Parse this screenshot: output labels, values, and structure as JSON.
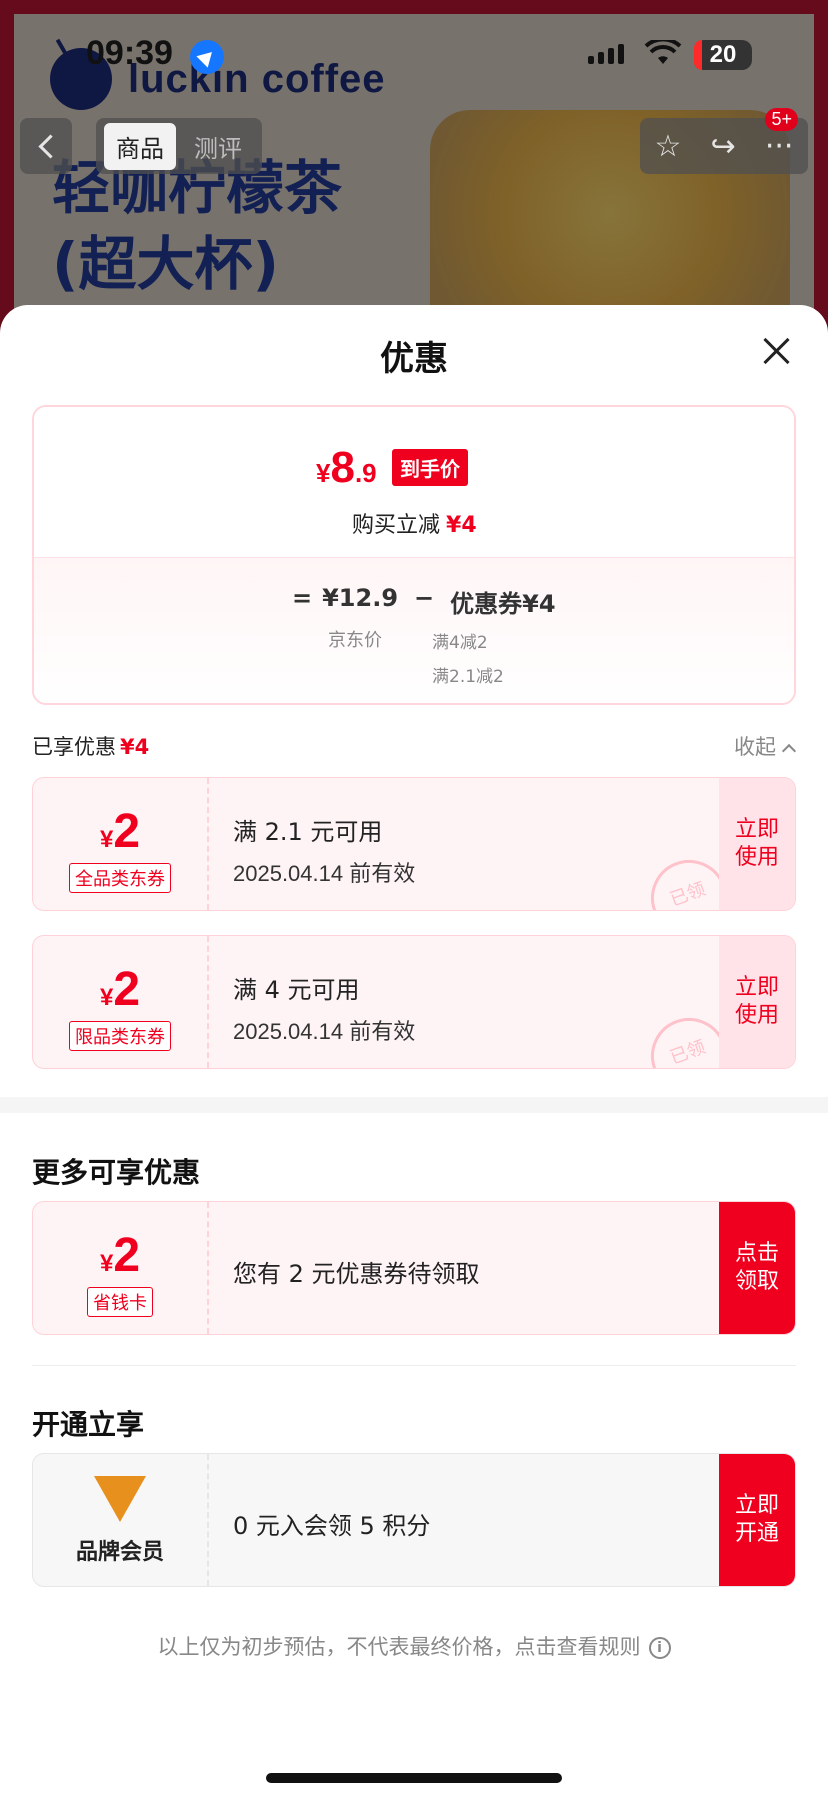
{
  "status_bar": {
    "time": "09:39",
    "battery": "20"
  },
  "background": {
    "brand": "luckin coffee",
    "product_title_line1": "轻咖柠檬茶",
    "product_title_line2": "(超大杯)"
  },
  "nav": {
    "tabs": [
      "商品",
      "测评"
    ],
    "badge": "5+"
  },
  "sheet": {
    "title": "优惠",
    "summary": {
      "currency": "¥",
      "price_int": "8",
      "price_dec": ".9",
      "tag": "到手价",
      "instant_label": "购买立减",
      "instant_amount": "¥4",
      "eq": "=",
      "jd_price": "¥12.9",
      "minus": "−",
      "coupon_total": "优惠券¥4",
      "jd_price_label": "京东价",
      "rule1": "满4减2",
      "rule2": "满2.1减2"
    },
    "enjoyed_label": "已享优惠",
    "enjoyed_amount": "¥4",
    "collapse_label": "收起",
    "coupons": [
      {
        "currency": "¥",
        "amount": "2",
        "type": "全品类东券",
        "desc": "满 2.1 元可用",
        "valid": "2025.04.14 前有效",
        "action": "立即使用",
        "stamp": "已领"
      },
      {
        "currency": "¥",
        "amount": "2",
        "type": "限品类东券",
        "desc": "满 4 元可用",
        "valid": "2025.04.14 前有效",
        "action": "立即使用",
        "stamp": "已领"
      }
    ],
    "more_title": "更多可享优惠",
    "more": {
      "currency": "¥",
      "amount": "2",
      "type": "省钱卡",
      "desc": "您有 2 元优惠券待领取",
      "action": "点击领取"
    },
    "open_title": "开通立享",
    "member": {
      "name": "品牌会员",
      "desc": "0 元入会领 5 积分",
      "action": "立即开通"
    },
    "footnote": "以上仅为初步预估，不代表最终价格，点击查看规则"
  },
  "colors": {
    "accent": "#f0001f",
    "coupon_bg": "#fff4f5"
  }
}
